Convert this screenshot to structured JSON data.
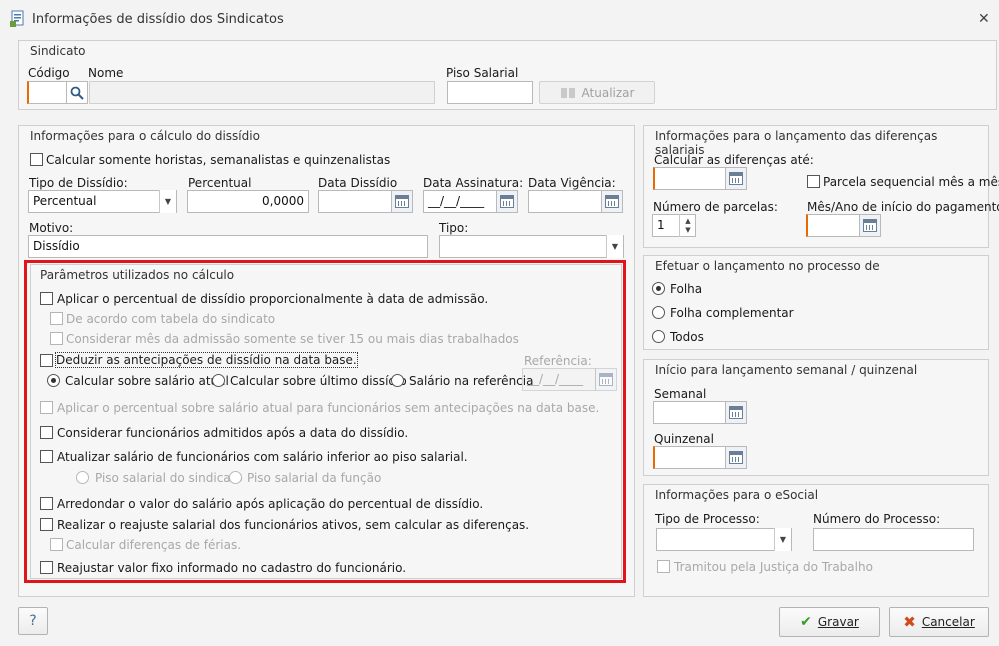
{
  "window": {
    "title": "Informações de dissídio dos Sindicatos"
  },
  "sindicato": {
    "title": "Sindicato",
    "codigo_label": "Código",
    "codigo_value": "",
    "nome_label": "Nome",
    "nome_value": "",
    "piso_label": "Piso Salarial",
    "piso_value": "",
    "atualizar_label": "Atualizar"
  },
  "calculo": {
    "title": "Informações para o cálculo do dissídio",
    "horistas_label": "Calcular somente horistas, semanalistas e quinzenalistas",
    "tipo_label": "Tipo de Dissídio:",
    "tipo_value": "Percentual",
    "percentual_label": "Percentual",
    "percentual_value": "0,0000",
    "data_dissidio_label": "Data Dissídio",
    "data_dissidio_value": "",
    "data_assinatura_label": "Data Assinatura:",
    "data_assinatura_value": "__/__/____",
    "data_vigencia_label": "Data Vigência:",
    "data_vigencia_value": "",
    "motivo_label": "Motivo:",
    "motivo_value": "Dissídio",
    "tipo2_label": "Tipo:",
    "tipo2_value": ""
  },
  "parametros": {
    "title": "Parâmetros utilizados no cálculo",
    "aplicar_proporcional": "Aplicar o percentual de dissídio proporcionalmente à data de admissão.",
    "tabela_sindicato": "De acordo com tabela do sindicato",
    "considerar_mes": "Considerar mês da admissão somente se tiver 15 ou mais dias trabalhados",
    "deduzir": "Deduzir as antecipações de dissídio na data base.",
    "referencia_label": "Referência:",
    "referencia_value": "__/__/____",
    "calc_atual": "Calcular sobre salário atual",
    "calc_ultimo": "Calcular sobre último dissídio",
    "salario_ref": "Salário na referência",
    "aplicar_sem_antecipacao": "Aplicar o percentual sobre salário atual para funcionários sem antecipações na data base.",
    "considerar_admitidos": "Considerar funcionários admitidos após a data do dissídio.",
    "atualizar_piso": "Atualizar salário de funcionários com salário inferior ao piso salarial.",
    "piso_sindicato": "Piso salarial do sindicato",
    "piso_funcao": "Piso salarial da função",
    "arredondar": "Arredondar o valor do salário após aplicação do percentual de dissídio.",
    "realizar_reajuste": "Realizar o reajuste salarial dos funcionários ativos, sem calcular as diferenças.",
    "calcular_ferias": "Calcular diferenças de férias.",
    "reajustar_fixo": "Reajustar valor fixo informado no cadastro do funcionário."
  },
  "lancamento": {
    "title": "Informações para o lançamento das diferenças salariais",
    "calcular_ate_label": "Calcular as diferenças até:",
    "calcular_ate_value": "",
    "parcela_label": "Parcela sequencial mês a mês",
    "parcelas_label": "Número de parcelas:",
    "parcelas_value": "1",
    "mes_ano_label": "Mês/Ano de início do pagamento:",
    "mes_ano_value": ""
  },
  "efetuar": {
    "title": "Efetuar o lançamento no processo de",
    "folha": "Folha",
    "complementar": "Folha complementar",
    "todos": "Todos"
  },
  "inicio": {
    "title": "Início para lançamento semanal / quinzenal",
    "semanal_label": "Semanal",
    "semanal_value": "",
    "quinzenal_label": "Quinzenal",
    "quinzenal_value": ""
  },
  "esocial": {
    "title": "Informações para o eSocial",
    "tipo_processo_label": "Tipo de Processo:",
    "tipo_processo_value": "",
    "numero_processo_label": "Número do Processo:",
    "numero_processo_value": "",
    "tramitou_label": "Tramitou pela Justiça do Trabalho"
  },
  "footer": {
    "help_label": "?",
    "gravar_label": "Gravar",
    "cancelar_label": "Cancelar"
  },
  "colors": {
    "highlight": "#e0141b",
    "accent": "#e86a00"
  }
}
